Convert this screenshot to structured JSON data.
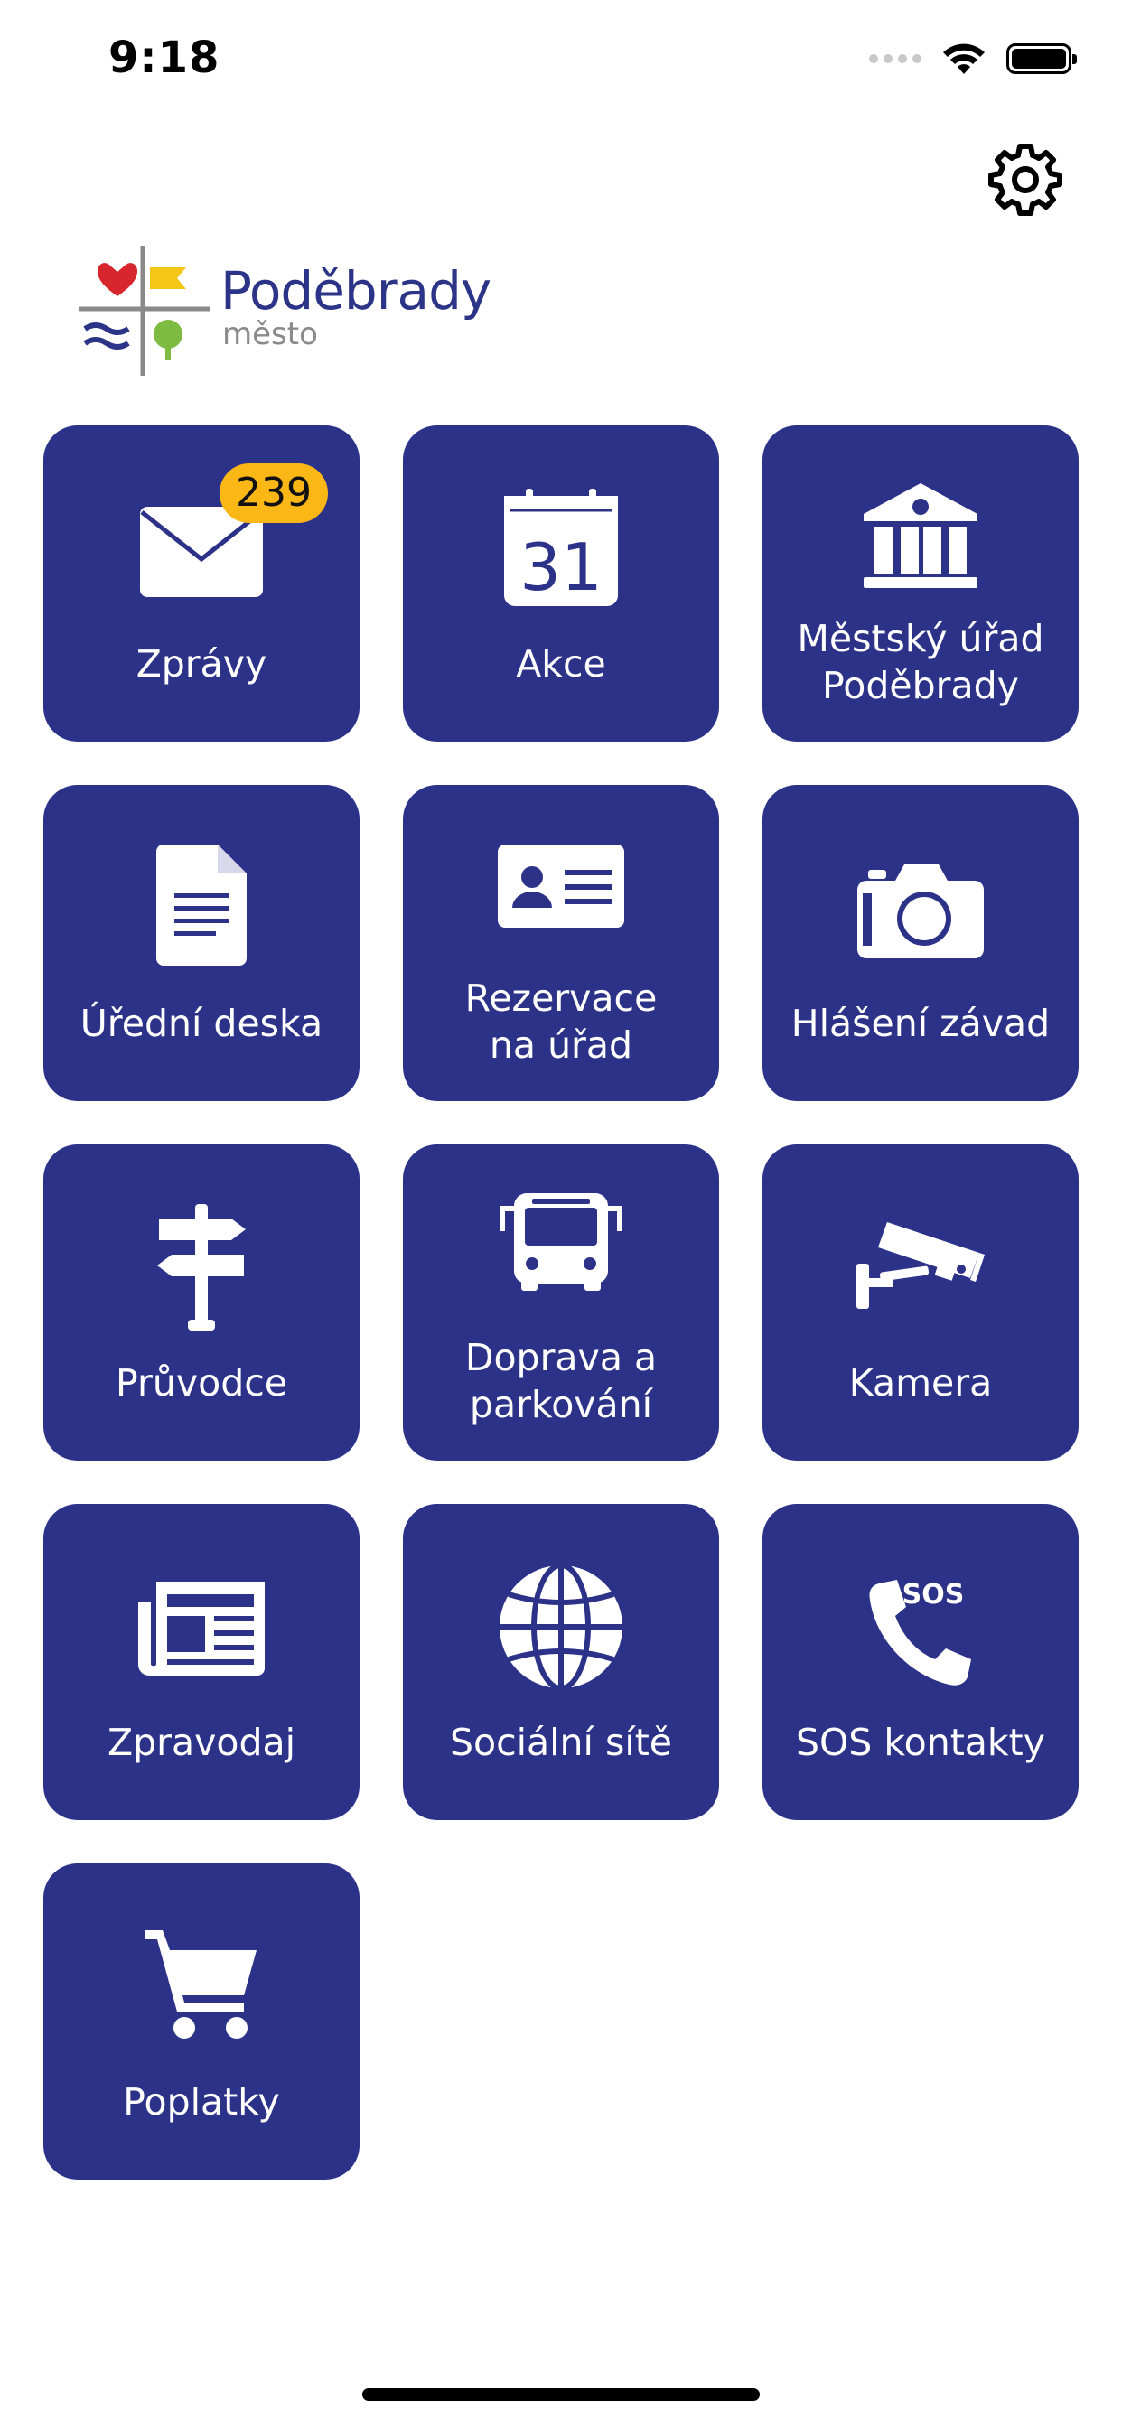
{
  "status_bar": {
    "time": "9:18"
  },
  "header": {
    "logo_title": "Poděbrady",
    "logo_subtitle": "město"
  },
  "colors": {
    "tile_background": "#2d3289",
    "badge_background": "#fbb715",
    "logo_text": "#2b3487"
  },
  "tiles": [
    {
      "label": "Zprávy",
      "icon": "envelope-icon",
      "badge": "239"
    },
    {
      "label": "Akce",
      "icon": "calendar-icon",
      "calendar_day": "31"
    },
    {
      "label": "Městský úřad\nPoděbrady",
      "icon": "town-hall-icon"
    },
    {
      "label": "Úřední deska",
      "icon": "document-icon"
    },
    {
      "label": "Rezervace\nna úřad",
      "icon": "id-card-icon"
    },
    {
      "label": "Hlášení závad",
      "icon": "camera-icon"
    },
    {
      "label": "Průvodce",
      "icon": "signpost-icon"
    },
    {
      "label": "Doprava a\nparkování",
      "icon": "bus-icon"
    },
    {
      "label": "Kamera",
      "icon": "cctv-camera-icon"
    },
    {
      "label": "Zpravodaj",
      "icon": "newspaper-icon"
    },
    {
      "label": "Sociální sítě",
      "icon": "globe-icon"
    },
    {
      "label": "SOS kontakty",
      "icon": "sos-phone-icon",
      "icon_text": "SOS"
    },
    {
      "label": "Poplatky",
      "icon": "shopping-cart-icon"
    }
  ]
}
